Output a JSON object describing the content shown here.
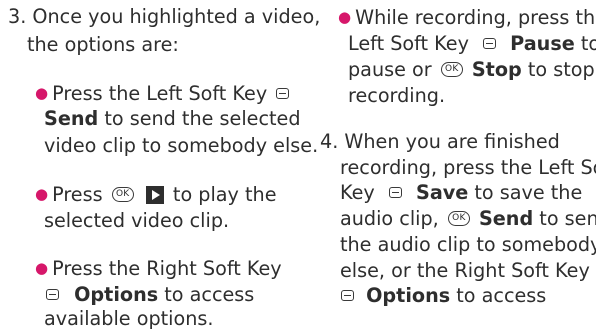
{
  "left": {
    "step3_num": "3.",
    "step3_l1": "Once you highlighted a video,",
    "step3_l2": "the options are:",
    "b1_l1_a": "Press the Left Soft Key",
    "b1_l2_bold": "Send",
    "b1_l2_b": " to send the selected",
    "b1_l3": "video clip to somebody else.",
    "b2_l1_a": "Press ",
    "b2_l1_b": " to play the",
    "b2_l2": "selected video clip.",
    "b3_l1": "Press the Right Soft Key",
    "b3_l2_bold": "Options",
    "b3_l2_b": " to access",
    "b3_l3": "available options."
  },
  "right": {
    "b4_l1": "While recording, press the",
    "b4_l2_a": "Left Soft Key",
    "b4_l2_bold": "Pause",
    "b4_l2_b": " to",
    "b4_l3_a": "pause or ",
    "b4_l3_bold": "Stop",
    "b4_l3_b": " to stop",
    "b4_l4": "recording.",
    "step4_num": "4.",
    "step4_l1": "When you are finished",
    "step4_l2": "recording, press the Left Soft",
    "step4_l3_a": "Key",
    "step4_l3_bold": "Save",
    "step4_l3_b": " to save the",
    "step4_l4_a": "audio clip, ",
    "step4_l4_bold": "Send",
    "step4_l4_b": " to send",
    "step4_l5": "the audio clip to somebody",
    "step4_l6": "else, or the Right Soft Key",
    "step4_l7_bold": "Options",
    "step4_l7_b": " to access"
  },
  "icons": {
    "ok_label": "OK",
    "bullet_color": "#d6176a"
  }
}
